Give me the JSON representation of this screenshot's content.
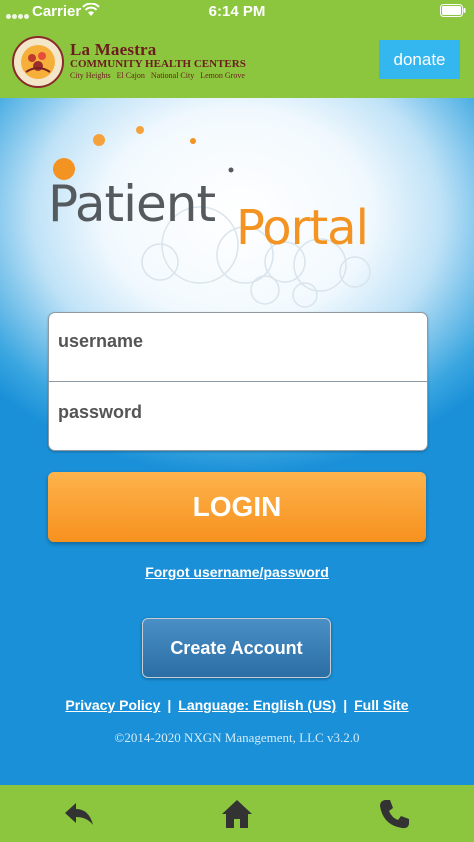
{
  "status_bar": {
    "carrier": "Carrier",
    "time": "6:14 PM",
    "icons": [
      "signal-dots-icon",
      "wifi-icon",
      "battery-icon"
    ]
  },
  "header": {
    "seal_text": [
      "FAMILY",
      "COMMUNITY",
      "CARING",
      "HEALTH",
      "WELLNESS"
    ],
    "org_name": "La Maestra",
    "org_sub": "COMMUNITY HEALTH CENTERS",
    "cities": "City Heights   El Cajon   National City   Lemon Grove",
    "donate_label": "donate"
  },
  "portal_logo": {
    "word1": "Patient",
    "word2": "Portal"
  },
  "login": {
    "username_placeholder": "username",
    "username_value": "",
    "password_placeholder": "password",
    "password_value": "",
    "login_label": "LOGIN",
    "forgot_label": "Forgot username/password"
  },
  "create_account_label": "Create Account",
  "footer": {
    "privacy_label": "Privacy Policy",
    "language_label": "Language: English (US)",
    "full_site_label": "Full Site",
    "separator": "|",
    "copyright": "©2014-2020 NXGN Management, LLC v3.2.0"
  },
  "tab_bar": {
    "icons": [
      "back-arrow-icon",
      "home-icon",
      "phone-icon"
    ]
  },
  "colors": {
    "brand_green": "#8cc63f",
    "donate_blue": "#34b6ee",
    "login_orange": "#f7911e",
    "background_blue": "#1a90d8",
    "logo_maroon": "#6b1d1d"
  }
}
